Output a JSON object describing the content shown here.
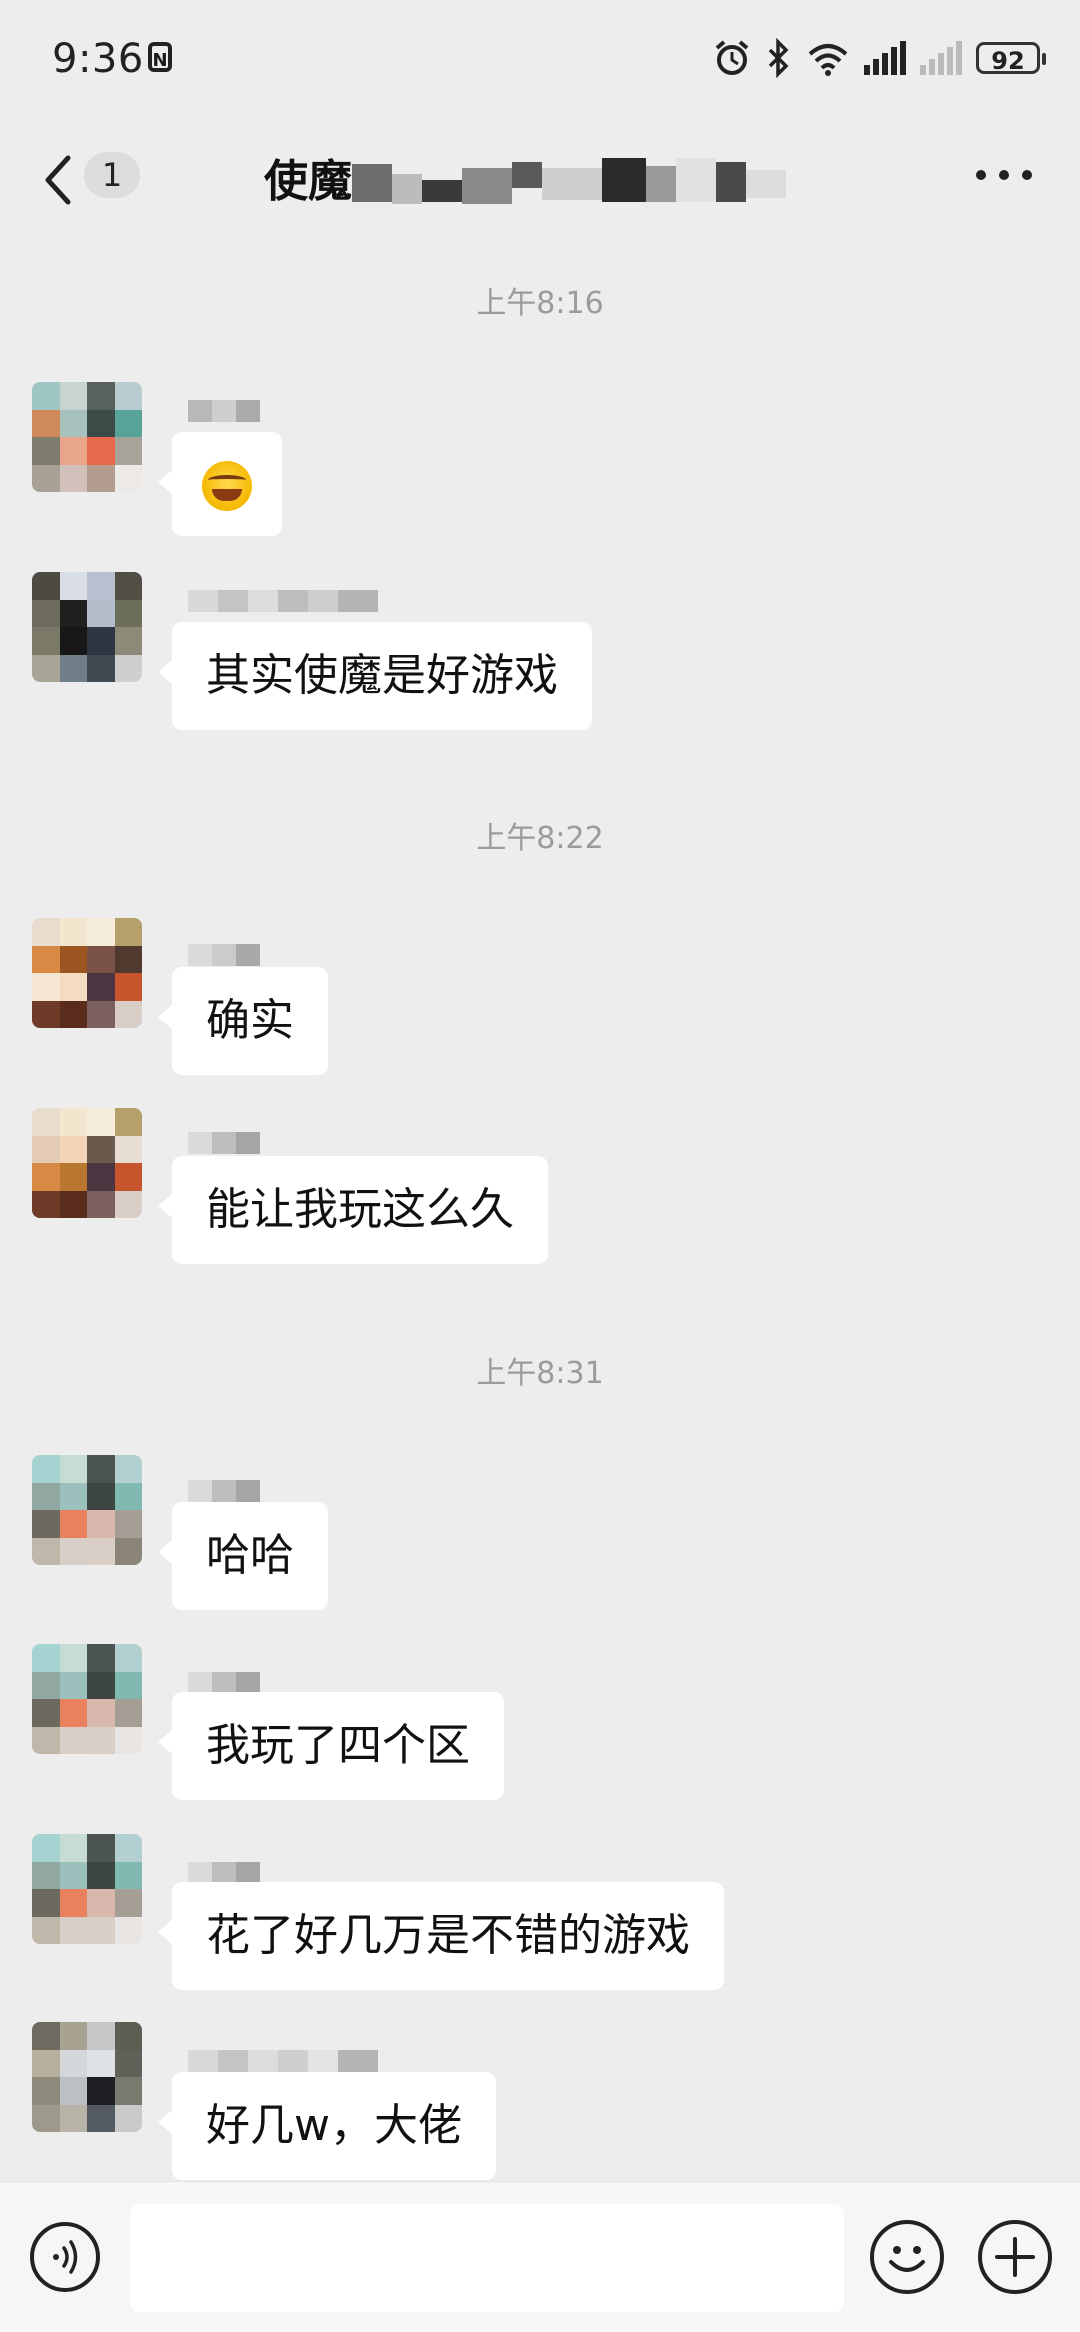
{
  "status_bar": {
    "time": "9:36",
    "nfc_label": "N",
    "battery": "92",
    "icons": [
      "nfc-icon",
      "alarm-icon",
      "bluetooth-icon",
      "wifi-icon",
      "signal-icon",
      "signal-weak-icon",
      "battery-icon"
    ]
  },
  "header": {
    "back_icon": "chevron-left-icon",
    "unread_count": "1",
    "title": "使魔",
    "more_icon": "more-icon"
  },
  "chat": {
    "timestamps": [
      "上午8:16",
      "上午8:22",
      "上午8:31"
    ],
    "messages": [
      {
        "text": "",
        "emoji": "rolling-on-floor-laughing-emoji"
      },
      {
        "text": "其实使魔是好游戏"
      },
      {
        "text": "确实"
      },
      {
        "text": "能让我玩这么久"
      },
      {
        "text": "哈哈"
      },
      {
        "text": "我玩了四个区"
      },
      {
        "text": "花了好几万是不错的游戏"
      },
      {
        "text": "好几w，大佬"
      }
    ]
  },
  "input_bar": {
    "voice_icon": "voice-icon",
    "input_value": "",
    "emoji_icon": "emoji-icon",
    "plus_icon": "plus-icon"
  },
  "colors": {
    "background": "#ededed",
    "bubble": "#ffffff",
    "timestamp": "#9b9b9b",
    "input_bar": "#f6f6f6"
  }
}
